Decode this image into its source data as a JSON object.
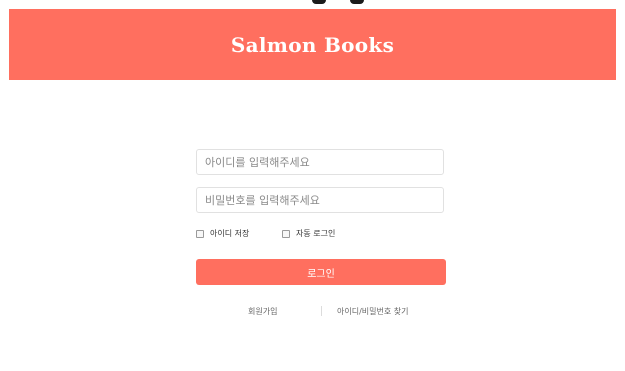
{
  "header": {
    "title": "Salmon Books"
  },
  "form": {
    "id_placeholder": "아이디를 입력해주세요",
    "password_placeholder": "비밀번호를 입력해주세요",
    "save_id_label": "아이디 저장",
    "auto_login_label": "자동 로그인",
    "login_button_label": "로그인"
  },
  "footer": {
    "signup_label": "회원가입",
    "find_label": "아이디/비밀번호 찾기"
  },
  "colors": {
    "accent": "#ff6f5f",
    "background": "#ffffff"
  }
}
